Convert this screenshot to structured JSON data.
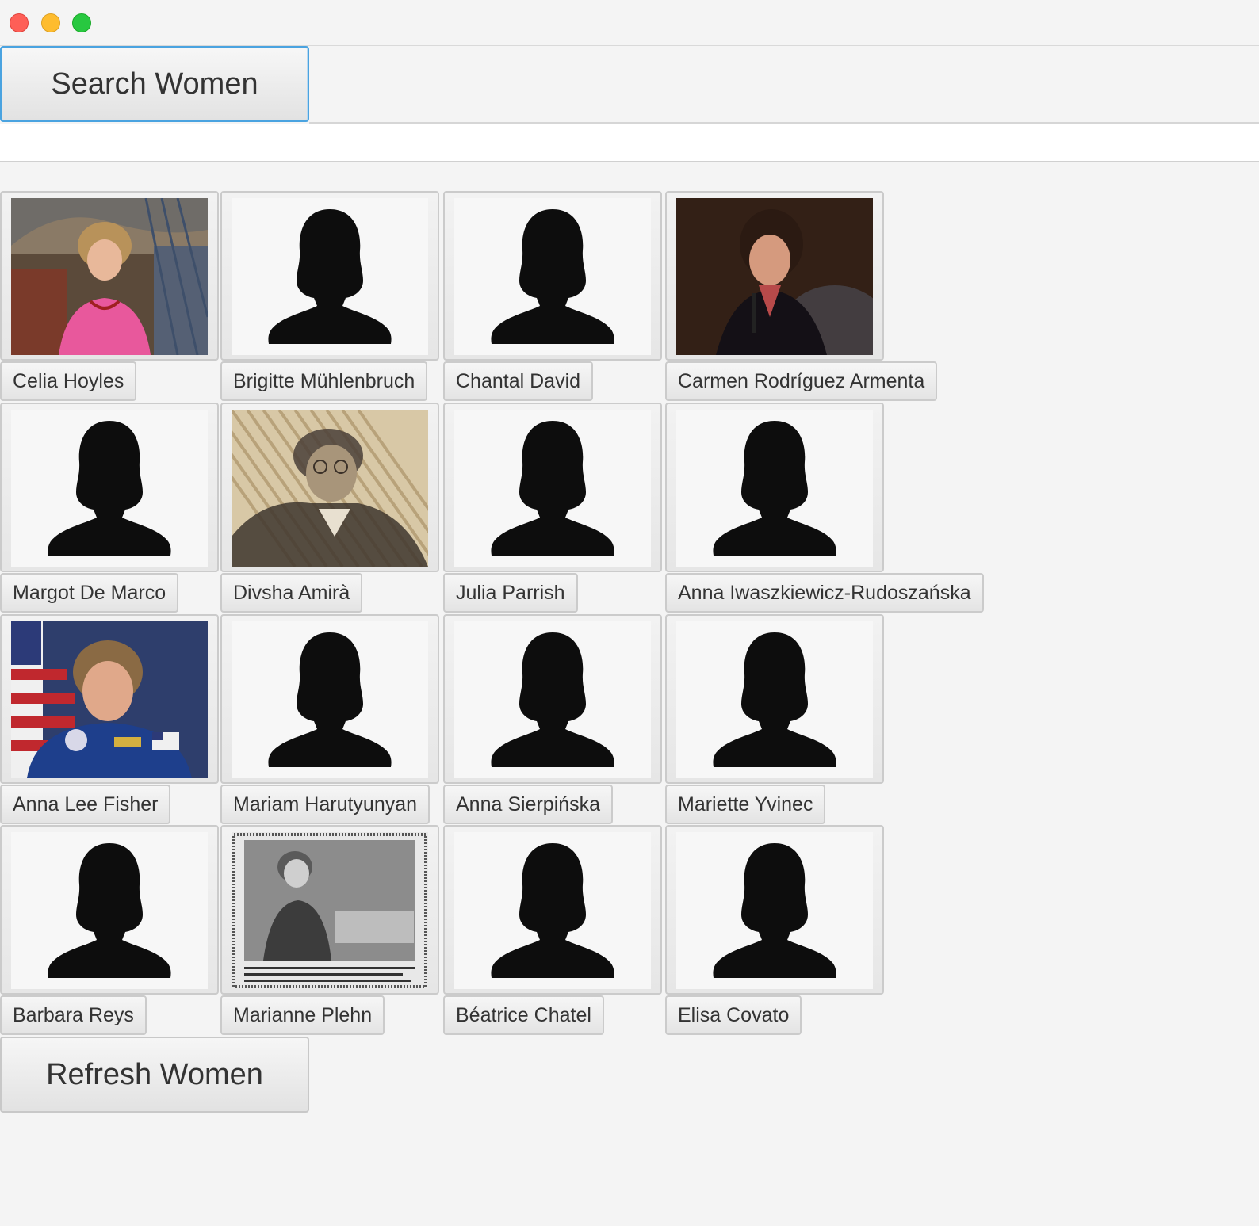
{
  "window": {
    "controls": [
      "close-icon",
      "minimize-icon",
      "zoom-icon"
    ],
    "colors": {
      "close": "#fe5f57",
      "minimize": "#febc2e",
      "zoom": "#28c840"
    }
  },
  "toolbar": {
    "search_label": "Search Women",
    "search_value": "",
    "refresh_label": "Refresh Women"
  },
  "women": [
    {
      "name": "Celia Hoyles",
      "photo": "photo-curly-hair-pink-top"
    },
    {
      "name": "Brigitte Mühlenbruch",
      "photo": "placeholder-silhouette-icon"
    },
    {
      "name": "Chantal David",
      "photo": "placeholder-silhouette-icon"
    },
    {
      "name": "Carmen Rodríguez Armenta",
      "photo": "photo-speaker-dark-background"
    },
    {
      "name": "Margot De Marco",
      "photo": "placeholder-silhouette-icon"
    },
    {
      "name": "Divsha Amirà",
      "photo": "photo-sepia-portrait"
    },
    {
      "name": "Julia Parrish",
      "photo": "placeholder-silhouette-icon"
    },
    {
      "name": "Anna Iwaszkiewicz-Rudoszańska",
      "photo": "placeholder-silhouette-icon"
    },
    {
      "name": "Anna Lee Fisher",
      "photo": "photo-astronaut-flag"
    },
    {
      "name": "Mariam Harutyunyan",
      "photo": "placeholder-silhouette-icon"
    },
    {
      "name": "Anna Sierpińska",
      "photo": "placeholder-silhouette-icon"
    },
    {
      "name": "Mariette Yvinec",
      "photo": "placeholder-silhouette-icon"
    },
    {
      "name": "Barbara Reys",
      "photo": "placeholder-silhouette-icon"
    },
    {
      "name": "Marianne Plehn",
      "photo": "photo-newspaper-clipping"
    },
    {
      "name": "Béatrice Chatel",
      "photo": "placeholder-silhouette-icon"
    },
    {
      "name": "Elisa Covato",
      "photo": "placeholder-silhouette-icon"
    }
  ]
}
